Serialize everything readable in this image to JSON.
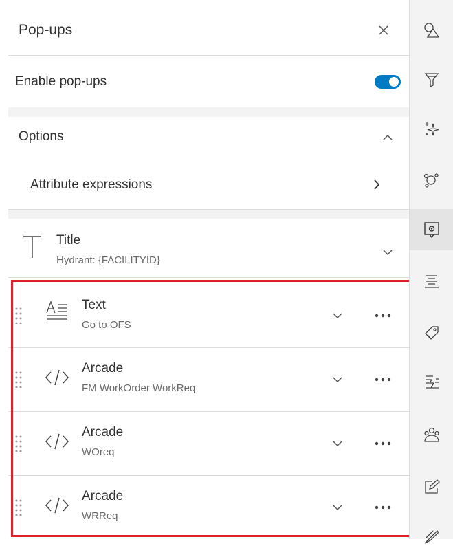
{
  "header": {
    "title": "Pop-ups"
  },
  "enable_row": {
    "label": "Enable pop-ups",
    "enabled": true,
    "accent_color": "#007ac2"
  },
  "options": {
    "label": "Options",
    "attribute_expressions_label": "Attribute expressions"
  },
  "title_element": {
    "label": "Title",
    "value": "Hydrant: {FACILITYID}"
  },
  "content_elements": [
    {
      "type_label": "Text",
      "detail": "Go to OFS",
      "icon": "text-icon"
    },
    {
      "type_label": "Arcade",
      "detail": "FM WorkOrder WorkReq",
      "icon": "code-icon"
    },
    {
      "type_label": "Arcade",
      "detail": "WOreq",
      "icon": "code-icon"
    },
    {
      "type_label": "Arcade",
      "detail": "WRReq",
      "icon": "code-icon"
    }
  ],
  "highlight_color": "#e0202a",
  "sidebar_icons": [
    "shapes-icon",
    "filter-icon",
    "effects-icon",
    "clustering-icon",
    "popup-config-icon",
    "fields-icon",
    "label-icon",
    "forms-icon",
    "sharing-icon",
    "edit-icon",
    "sketch-icon"
  ],
  "active_sidebar_icon": "popup-config-icon"
}
